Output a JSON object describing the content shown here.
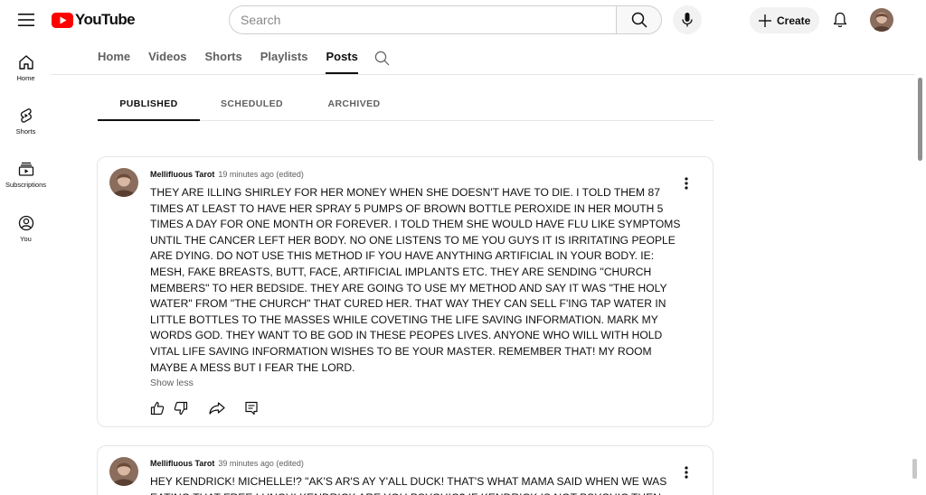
{
  "header": {
    "logo_text": "YouTube",
    "search_placeholder": "Search",
    "create_label": "Create"
  },
  "sidebar": {
    "items": [
      {
        "label": "Home",
        "icon": "home-icon"
      },
      {
        "label": "Shorts",
        "icon": "shorts-icon"
      },
      {
        "label": "Subscriptions",
        "icon": "subscriptions-icon"
      },
      {
        "label": "You",
        "icon": "you-icon"
      }
    ]
  },
  "channel_tabs": [
    "Home",
    "Videos",
    "Shorts",
    "Playlists",
    "Posts"
  ],
  "channel_tabs_active": "Posts",
  "sub_tabs": [
    "PUBLISHED",
    "SCHEDULED",
    "ARCHIVED"
  ],
  "sub_tabs_active": "PUBLISHED",
  "posts": [
    {
      "author": "Mellifluous Tarot",
      "time": "19 minutes ago (edited)",
      "body": "THEY ARE ILLING SHIRLEY FOR HER MONEY WHEN SHE DOESN'T HAVE TO DIE. I TOLD THEM 87 TIMES AT LEAST TO HAVE HER SPRAY 5 PUMPS OF BROWN BOTTLE PEROXIDE IN HER MOUTH 5 TIMES A DAY FOR ONE MONTH OR FOREVER. I TOLD THEM SHE WOULD HAVE FLU LIKE SYMPTOMS UNTIL THE CANCER LEFT HER BODY. NO ONE LISTENS TO ME YOU GUYS IT IS IRRITATING PEOPLE ARE DYING. DO NOT USE THIS METHOD IF YOU HAVE ANYTHING ARTIFICIAL IN YOUR BODY. IE: MESH, FAKE BREASTS, BUTT, FACE, ARTIFICIAL IMPLANTS ETC. THEY ARE SENDING \"CHURCH MEMBERS\" TO HER BEDSIDE. THEY ARE GOING TO USE MY METHOD AND SAY IT WAS \"THE HOLY WATER\" FROM \"THE CHURCH\" THAT CURED HER. THAT WAY THEY CAN SELL F'ING TAP WATER IN LITTLE BOTTLES TO THE MASSES WHILE COVETING THE LIFE SAVING INFORMATION. MARK MY WORDS GOD. THEY WANT TO BE GOD IN THESE PEOPES LIVES. ANYONE WHO WILL WITH HOLD VITAL LIFE SAVING INFORMATION WISHES TO BE YOUR MASTER. REMEMBER THAT! MY ROOM MAYBE A MESS BUT I FEAR THE LORD.",
      "show_less": "Show less"
    },
    {
      "author": "Mellifluous Tarot",
      "time": "39 minutes ago (edited)",
      "body": "HEY KENDRICK! MICHELLE!? \"AK'S AR'S AY Y'ALL DUCK! THAT'S WHAT MAMA SAID WHEN WE WAS EATING THAT FREE LUNCH! KENDRICK ARE YOU PSYCHIC? IF KENDRICK IS NOT PSYCHIC THEN"
    }
  ],
  "colors": {
    "brand_red": "#ff0000",
    "text_primary": "#0f0f0f",
    "text_secondary": "#606060"
  }
}
